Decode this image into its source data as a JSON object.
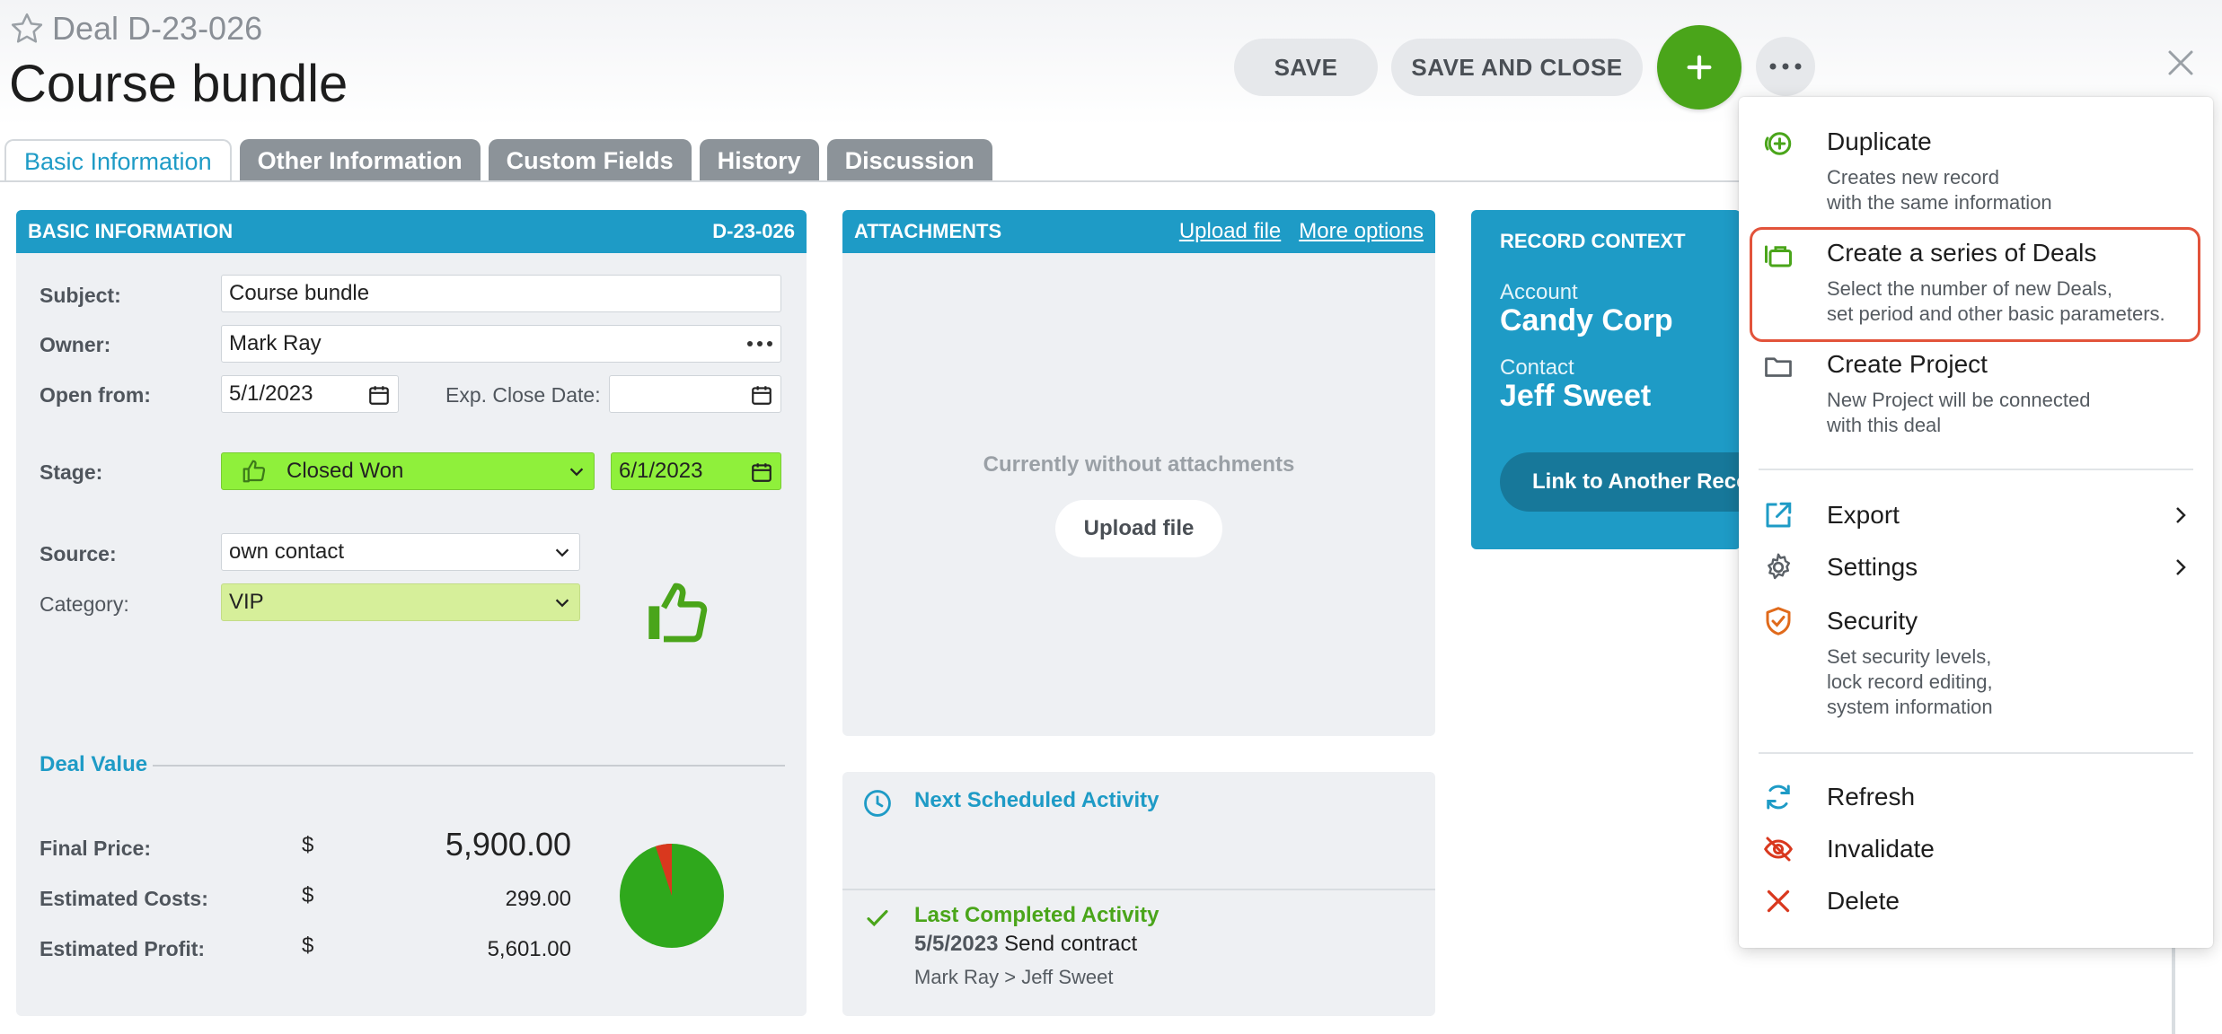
{
  "header": {
    "deal_id": "Deal D-23-026",
    "title": "Course bundle",
    "save_label": "SAVE",
    "save_close_label": "SAVE AND CLOSE"
  },
  "tabs": [
    {
      "label": "Basic Information",
      "active": true
    },
    {
      "label": "Other Information",
      "active": false
    },
    {
      "label": "Custom Fields",
      "active": false
    },
    {
      "label": "History",
      "active": false
    },
    {
      "label": "Discussion",
      "active": false
    }
  ],
  "basic_info": {
    "header": "BASIC INFORMATION",
    "code": "D-23-026",
    "subject_label": "Subject:",
    "subject_value": "Course bundle",
    "owner_label": "Owner:",
    "owner_value": "Mark Ray",
    "open_from_label": "Open from:",
    "open_from_value": "5/1/2023",
    "exp_close_label": "Exp. Close Date:",
    "exp_close_value": "",
    "stage_label": "Stage:",
    "stage_value": "Closed Won",
    "stage_date": "6/1/2023",
    "source_label": "Source:",
    "source_value": "own contact",
    "category_label": "Category:",
    "category_value": "VIP"
  },
  "deal_value": {
    "title": "Deal Value",
    "currency": "$",
    "rows": [
      {
        "label": "Final Price:",
        "value": "5,900.00"
      },
      {
        "label": "Estimated Costs:",
        "value": "299.00"
      },
      {
        "label": "Estimated Profit:",
        "value": "5,601.00"
      }
    ],
    "pie": {
      "profit": 5601,
      "costs": 299
    }
  },
  "attachments": {
    "header": "ATTACHMENTS",
    "upload_link": "Upload file",
    "more_options": "More options",
    "empty_text": "Currently without attachments",
    "upload_button": "Upload file"
  },
  "activity": {
    "next_title": "Next Scheduled Activity",
    "last_title": "Last Completed Activity",
    "last_date": "5/5/2023",
    "last_subject": "Send contract",
    "last_people": "Mark Ray > Jeff Sweet"
  },
  "record_context": {
    "title": "RECORD CONTEXT",
    "account_label": "Account",
    "account_value": "Candy Corp",
    "contact_label": "Contact",
    "contact_value": "Jeff Sweet",
    "link_button": "Link to Another Record"
  },
  "menu": {
    "duplicate": {
      "title": "Duplicate",
      "desc1": "Creates new record",
      "desc2": "with the same information"
    },
    "series": {
      "title": "Create a series of Deals",
      "desc1": "Select the number of new Deals,",
      "desc2": "set period and other basic parameters."
    },
    "project": {
      "title": "Create Project",
      "desc1": "New Project will be connected",
      "desc2": "with this deal"
    },
    "export": {
      "title": "Export"
    },
    "settings": {
      "title": "Settings"
    },
    "security": {
      "title": "Security",
      "desc1": "Set security levels,",
      "desc2": "lock record editing,",
      "desc3": "system information"
    },
    "refresh": {
      "title": "Refresh"
    },
    "invalidate": {
      "title": "Invalidate"
    },
    "delete": {
      "title": "Delete"
    }
  },
  "colors": {
    "accent": "#1e9bc6",
    "primary_green": "#4aa51a",
    "stage_green": "#8ff03b",
    "highlight_red": "#e2533b"
  }
}
